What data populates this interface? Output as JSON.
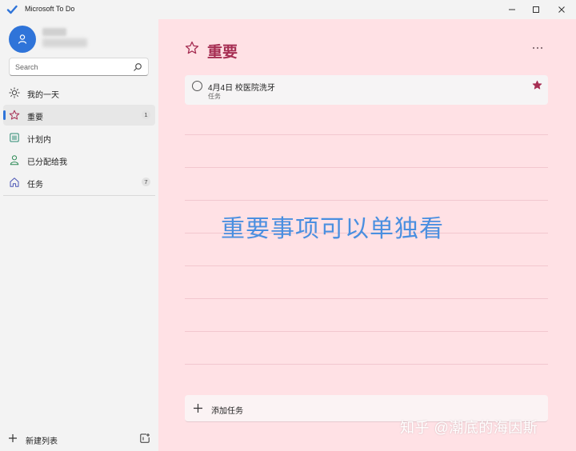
{
  "app": {
    "title": "Microsoft To Do"
  },
  "search": {
    "placeholder": "Search"
  },
  "sidebar": {
    "items": [
      {
        "label": "我的一天",
        "count": "",
        "icon": "sun-icon"
      },
      {
        "label": "重要",
        "count": "1",
        "icon": "star-icon"
      },
      {
        "label": "计划内",
        "count": "",
        "icon": "calendar-icon"
      },
      {
        "label": "已分配给我",
        "count": "",
        "icon": "person-icon"
      },
      {
        "label": "任务",
        "count": "7",
        "icon": "home-icon"
      }
    ],
    "new_list_label": "新建列表"
  },
  "main": {
    "title": "重要",
    "tasks": [
      {
        "title": "4月4日 校医院洗牙",
        "subtitle": "任务",
        "important": true
      }
    ],
    "add_task_label": "添加任务"
  },
  "overlay": {
    "caption": "重要事项可以单独看"
  },
  "watermark": {
    "text": "知乎 @潮底的海因斯"
  },
  "colors": {
    "accent": "#2f74d9",
    "important": "#a62e53",
    "main_background": "#ffe1e5",
    "sidebar_background": "#f3f3f3",
    "caption": "#4a8fe0"
  }
}
